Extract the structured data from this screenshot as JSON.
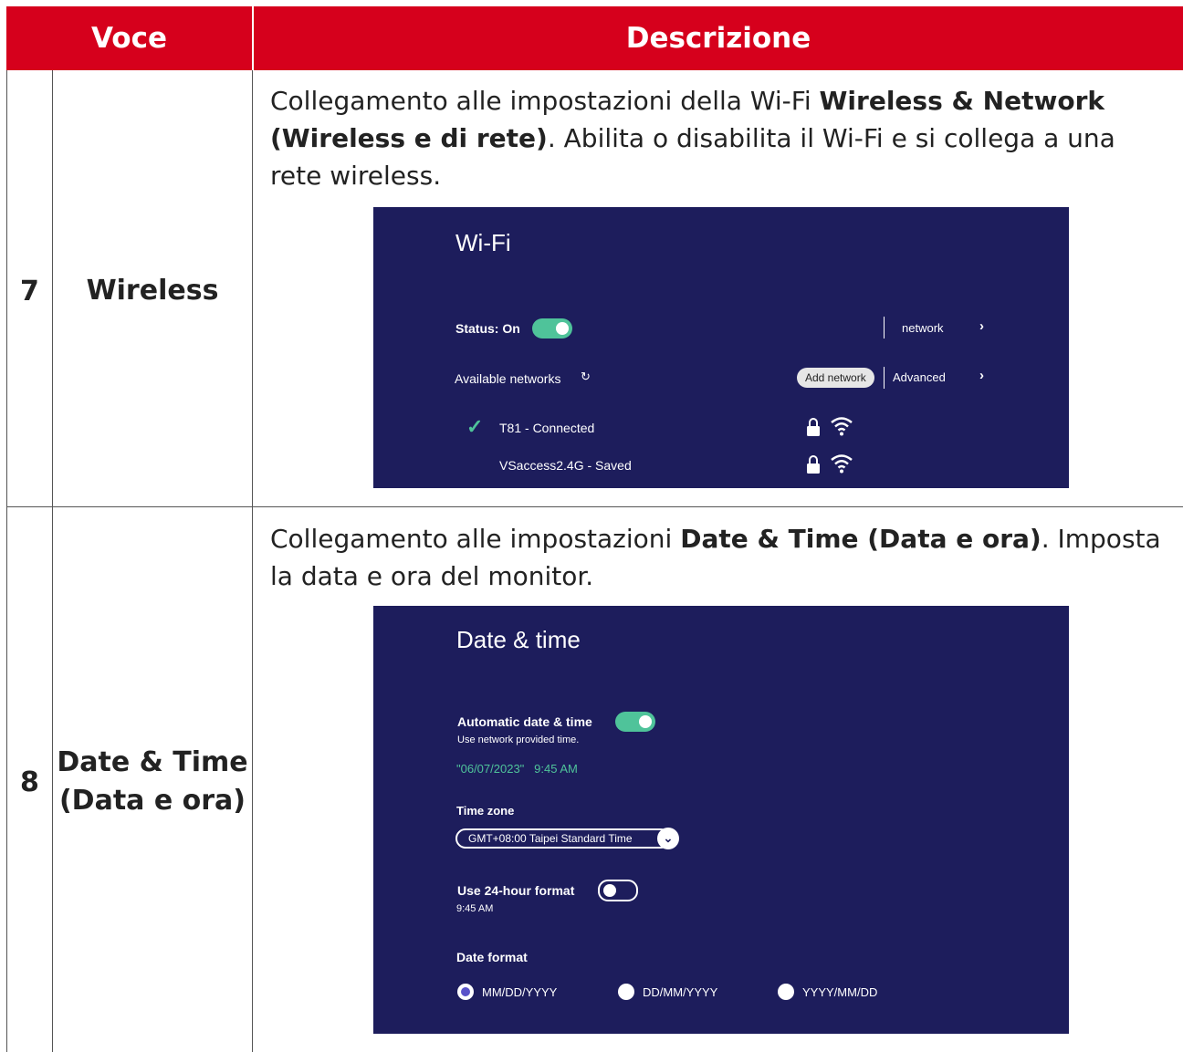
{
  "table": {
    "headers": {
      "item": "Voce",
      "description": "Descrizione"
    },
    "rows": [
      {
        "number": "7",
        "name": "Wireless",
        "desc_plain1": "Collegamento alle impostazioni della Wi-Fi ",
        "desc_bold1": "Wireless & Network (Wireless e di rete)",
        "desc_plain2": ". Abilita o disabilita il Wi-Fi e si collega a una rete wireless."
      },
      {
        "number": "8",
        "name_line1": "Date & Time",
        "name_line2": "(Data e ora)",
        "desc_plain1": "Collegamento alle impostazioni ",
        "desc_bold1": "Date & Time (Data e ora)",
        "desc_plain2": ". Imposta la data e ora del monitor."
      }
    ]
  },
  "wifi_panel": {
    "title": "Wi-Fi",
    "status_label": "Status: On",
    "status_on": true,
    "network_label": "network",
    "available_label": "Available networks",
    "add_network": "Add network",
    "advanced": "Advanced",
    "networks": [
      {
        "name": "T81",
        "status": "- Connected",
        "connected": true
      },
      {
        "name": "VSaccess2.4G",
        "status": "- Saved",
        "connected": false
      }
    ]
  },
  "datetime_panel": {
    "title": "Date & time",
    "auto_label": "Automatic date & time",
    "auto_on": true,
    "auto_sub": "Use network provided time.",
    "current": "\"06/07/2023\"   9:45 AM",
    "timezone_label": "Time zone",
    "timezone_value": "GMT+08:00 Taipei Standard Time",
    "h24_label": "Use 24-hour format",
    "h24_on": false,
    "h24_sub": "9:45 AM",
    "date_format_label": "Date format",
    "formats": [
      "MM/DD/YYYY",
      "DD/MM/YYYY",
      "YYYY/MM/DD"
    ],
    "selected_format": "MM/DD/YYYY"
  },
  "colors": {
    "header_red": "#d6001c",
    "panel_navy": "#1d1d5c",
    "accent_green": "#4fc39a"
  }
}
